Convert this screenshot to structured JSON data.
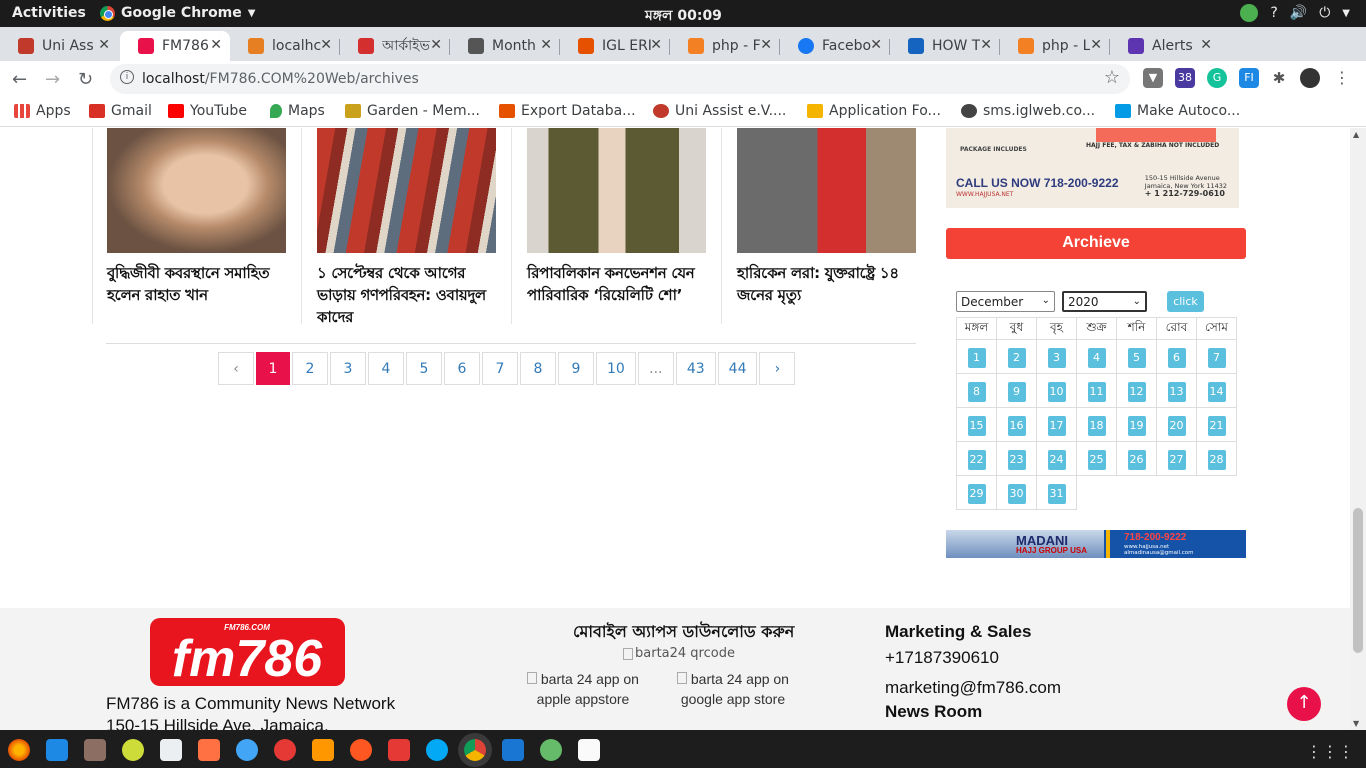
{
  "system": {
    "activities": "Activities",
    "app_name": "Google Chrome",
    "clock": "মঙ্গল 00:09"
  },
  "tabs": [
    {
      "title": "Uni Ass",
      "color": "#c0392b"
    },
    {
      "title": "FM786",
      "color": "#e8114a"
    },
    {
      "title": "localhc",
      "color": "#e67e22"
    },
    {
      "title": "আর্কাইভ",
      "color": "#d32f2f"
    },
    {
      "title": "Month",
      "color": "#555555"
    },
    {
      "title": "IGL ERI",
      "color": "#e65100"
    },
    {
      "title": "php - F",
      "color": "#f48024"
    },
    {
      "title": "Facebo",
      "color": "#1877f2"
    },
    {
      "title": "HOW T",
      "color": "#1565c0"
    },
    {
      "title": "php - L",
      "color": "#f48024"
    },
    {
      "title": "Alerts",
      "color": "#5e35b1"
    }
  ],
  "address_bar": {
    "host": "localhost",
    "path": "/FM786.COM%20Web/archives"
  },
  "bookmarks": [
    {
      "label": "Apps",
      "color": "#e8453c"
    },
    {
      "label": "Gmail",
      "color": "#d93025"
    },
    {
      "label": "YouTube",
      "color": "#ff0000"
    },
    {
      "label": "Maps",
      "color": "#34a853"
    },
    {
      "label": "Garden - Mem...",
      "color": "#caa11a"
    },
    {
      "label": "Export Databa...",
      "color": "#e65100"
    },
    {
      "label": "Uni Assist e.V....",
      "color": "#c0392b"
    },
    {
      "label": "Application Fo...",
      "color": "#f4b400"
    },
    {
      "label": "sms.iglweb.co...",
      "color": "#444444"
    },
    {
      "label": "Make Autoco...",
      "color": "#039be5"
    }
  ],
  "news": [
    {
      "title": "বুদ্ধিজীবী কবরস্থানে সমাহিত হলেন রাহাত খান"
    },
    {
      "title": "১ সেপ্টেম্বর থেকে আগের ভাড়ায় গণপরিবহন: ওবায়দুল কাদের"
    },
    {
      "title": "রিপাবলিকান কনভেনশন যেন পারিবারিক ‘রিয়েলিটি শো’"
    },
    {
      "title": "হারিকেন লরা: যুক্তরাষ্ট্রে ১৪ জনের মৃত্যু"
    }
  ],
  "pagination": {
    "prev": "‹",
    "next": "›",
    "pages": [
      "1",
      "2",
      "3",
      "4",
      "5",
      "6",
      "7",
      "8",
      "9",
      "10",
      "...",
      "43",
      "44"
    ],
    "current": "1"
  },
  "ad_top": {
    "package_title": "PACKAGE INCLUDES",
    "call": "CALL US NOW 718-200-9222",
    "address1": "150-15 Hillside Avenue",
    "address2": "Jamaica, New York 11432",
    "phone2": "+ 1 212-729-0610",
    "site": "WWW.HAJJUSA.NET",
    "fee_banner": "HAJJ FEE, TAX & ZABIHA NOT INCLUDED"
  },
  "archive": {
    "heading": "Archieve",
    "month": "December",
    "year": "2020",
    "button": "click",
    "weekdays": [
      "মঙ্গল",
      "বুধ",
      "বৃহ",
      "শুক্র",
      "শনি",
      "রোব",
      "সোম"
    ],
    "days": [
      "1",
      "2",
      "3",
      "4",
      "5",
      "6",
      "7",
      "8",
      "9",
      "10",
      "11",
      "12",
      "13",
      "14",
      "15",
      "16",
      "17",
      "18",
      "19",
      "20",
      "21",
      "22",
      "23",
      "24",
      "25",
      "26",
      "27",
      "28",
      "29",
      "30",
      "31"
    ]
  },
  "ad_bottom": {
    "name": "MADANI",
    "sub": "HAJJ GROUP USA",
    "phone": "718-200-9222",
    "web1": "www.hajjusa.net",
    "web2": "almadinausa@gmail.com"
  },
  "footer": {
    "logo_text": "fm786",
    "logo_small": "FM786.COM",
    "desc1": "FM786 is a Community News Network",
    "desc2": "150-15 Hillside Ave, Jamaica,",
    "apps_heading": "মোবাইল অ্যাপস ডাউনলোড করুন",
    "qr_alt": "barta24 qrcode",
    "apple_alt_1": "barta 24 app on",
    "apple_alt_2": "apple appstore",
    "google_alt_1": "barta 24 app on",
    "google_alt_2": "google app store",
    "marketing_heading": "Marketing & Sales",
    "phone": "+17187390610",
    "email": "marketing@fm786.com",
    "newsroom": "News Room"
  },
  "colors": {
    "accent": "#e8114a",
    "archive_header": "#f44336",
    "calendar_day": "#5bc0de"
  }
}
